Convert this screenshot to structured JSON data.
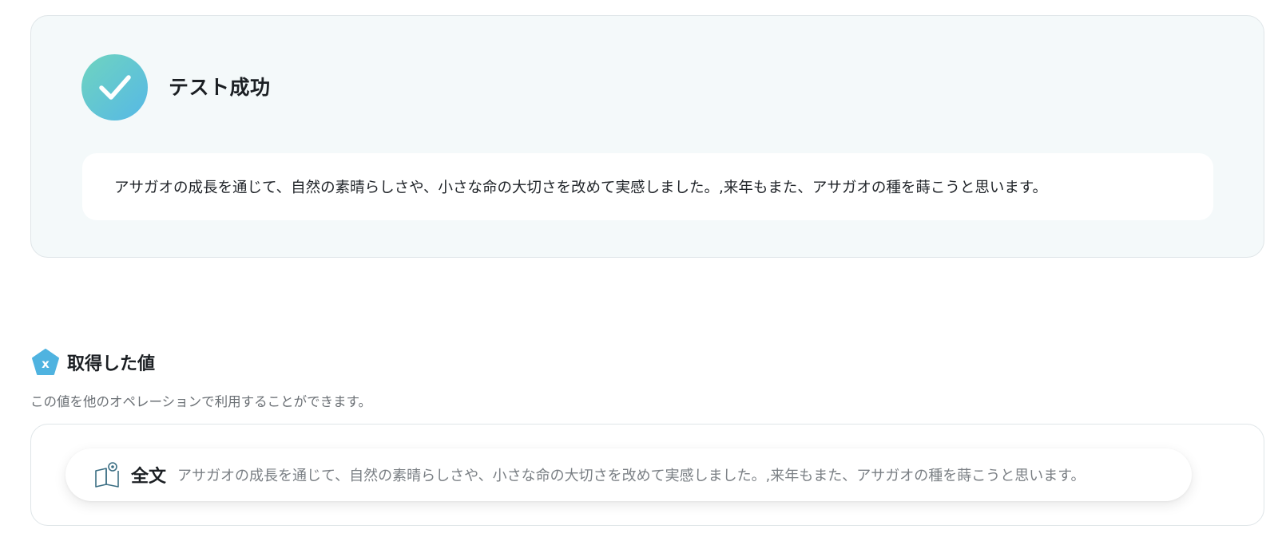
{
  "test_result": {
    "status_icon": "check-circle-icon",
    "title": "テスト成功",
    "output_text": "アサガオの成長を通じて、自然の素晴らしさや、小さな命の大切さを改めて実感しました。,来年もまた、アサガオの種を蒔こうと思います。"
  },
  "acquired_values": {
    "icon": "variable-pentagon-icon",
    "title": "取得した値",
    "description": "この値を他のオペレーションで利用することができます。",
    "items": [
      {
        "icon": "book-icon",
        "label": "全文",
        "value": "アサガオの成長を通じて、自然の素晴らしさや、小さな命の大切さを改めて実感しました。,来年もまた、アサガオの種を蒔こうと思います。"
      }
    ]
  },
  "colors": {
    "success_gradient_start": "#6fd4bf",
    "success_gradient_end": "#56b8e6",
    "card_background": "#f4f9fa",
    "variable_icon": "#4fb3e0"
  }
}
